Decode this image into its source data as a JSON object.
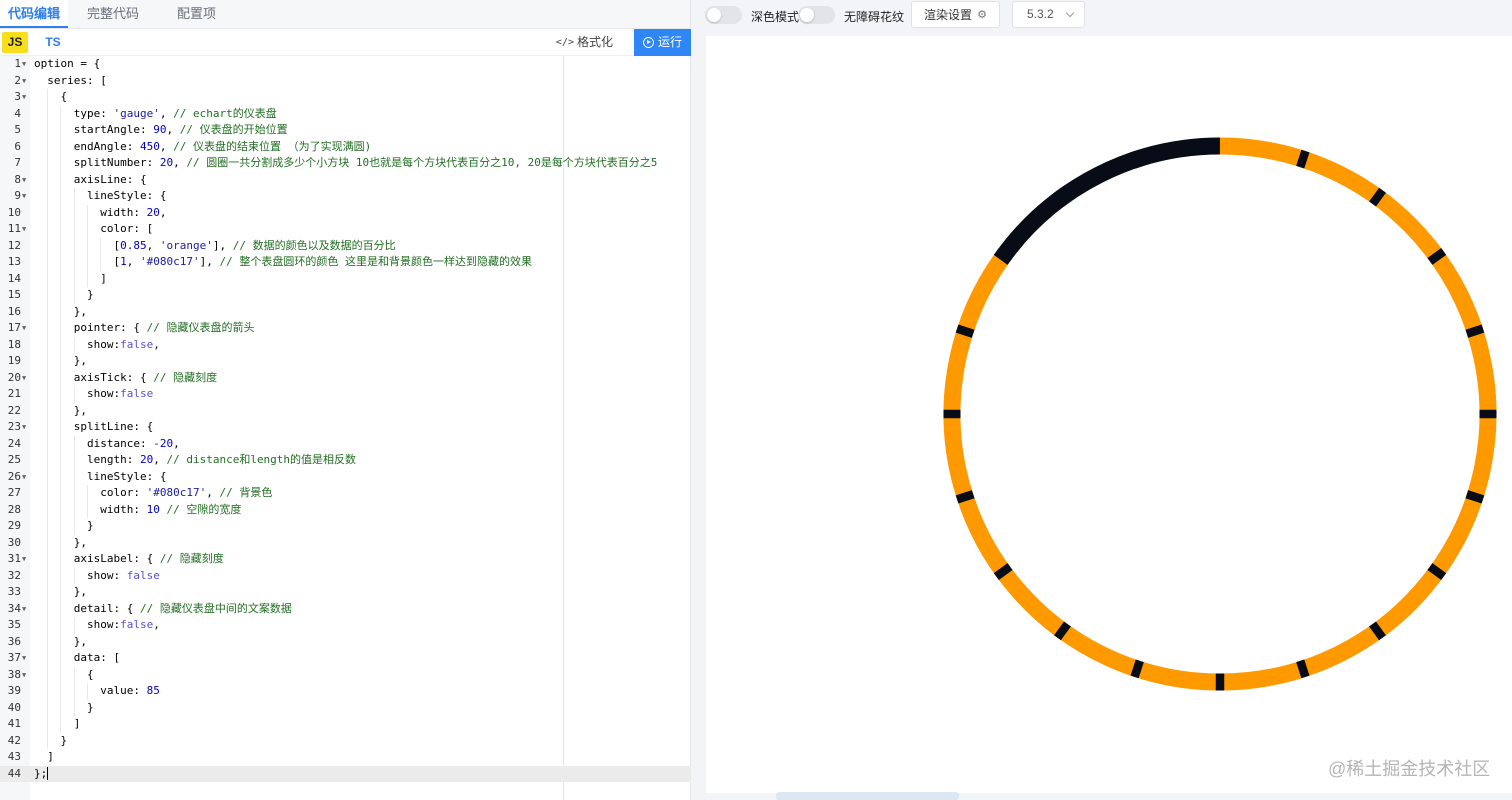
{
  "tabs": [
    {
      "label": "代码编辑",
      "active": true
    },
    {
      "label": "完整代码",
      "active": false
    },
    {
      "label": "配置项",
      "active": false
    }
  ],
  "lang": {
    "js": "JS",
    "ts": "TS"
  },
  "actions": {
    "format": "格式化",
    "format_icon": "</>",
    "run": "运行"
  },
  "code_lines": [
    [
      [
        "key",
        "option = {"
      ]
    ],
    [
      [
        "key",
        "  series: ["
      ]
    ],
    [
      [
        "key",
        "    {"
      ]
    ],
    [
      [
        "key",
        "      type: "
      ],
      [
        "str",
        "'gauge'"
      ],
      [
        "key",
        ", "
      ],
      [
        "com",
        "// echart的仪表盘"
      ]
    ],
    [
      [
        "key",
        "      startAngle: "
      ],
      [
        "num",
        "90"
      ],
      [
        "key",
        ", "
      ],
      [
        "com",
        "// 仪表盘的开始位置"
      ]
    ],
    [
      [
        "key",
        "      endAngle: "
      ],
      [
        "num",
        "450"
      ],
      [
        "key",
        ", "
      ],
      [
        "com",
        "// 仪表盘的结束位置 （为了实现满圆)"
      ]
    ],
    [
      [
        "key",
        "      splitNumber: "
      ],
      [
        "num",
        "20"
      ],
      [
        "key",
        ", "
      ],
      [
        "com",
        "// 圆圈一共分割成多少个小方块 10也就是每个方块代表百分之10, 20是每个方块代表百分之5"
      ]
    ],
    [
      [
        "key",
        "      axisLine: {"
      ]
    ],
    [
      [
        "key",
        "        lineStyle: {"
      ]
    ],
    [
      [
        "key",
        "          width: "
      ],
      [
        "num",
        "20"
      ],
      [
        "key",
        ","
      ]
    ],
    [
      [
        "key",
        "          color: ["
      ]
    ],
    [
      [
        "key",
        "            ["
      ],
      [
        "num",
        "0.85"
      ],
      [
        "key",
        ", "
      ],
      [
        "str",
        "'orange'"
      ],
      [
        "key",
        "], "
      ],
      [
        "com",
        "// 数据的颜色以及数据的百分比"
      ]
    ],
    [
      [
        "key",
        "            ["
      ],
      [
        "num",
        "1"
      ],
      [
        "key",
        ", "
      ],
      [
        "str",
        "'#080c17'"
      ],
      [
        "key",
        "], "
      ],
      [
        "com",
        "// 整个表盘圆环的颜色 这里是和背景颜色一样达到隐藏的效果"
      ]
    ],
    [
      [
        "key",
        "          ]"
      ]
    ],
    [
      [
        "key",
        "        }"
      ]
    ],
    [
      [
        "key",
        "      },"
      ]
    ],
    [
      [
        "key",
        "      pointer: { "
      ],
      [
        "com",
        "// 隐藏仪表盘的箭头"
      ]
    ],
    [
      [
        "key",
        "        show:"
      ],
      [
        "bool",
        "false"
      ],
      [
        "key",
        ","
      ]
    ],
    [
      [
        "key",
        "      },"
      ]
    ],
    [
      [
        "key",
        "      axisTick: { "
      ],
      [
        "com",
        "// 隐藏刻度"
      ]
    ],
    [
      [
        "key",
        "        show:"
      ],
      [
        "bool",
        "false"
      ]
    ],
    [
      [
        "key",
        "      },"
      ]
    ],
    [
      [
        "key",
        "      splitLine: {"
      ]
    ],
    [
      [
        "key",
        "        distance: "
      ],
      [
        "num",
        "-20"
      ],
      [
        "key",
        ","
      ]
    ],
    [
      [
        "key",
        "        length: "
      ],
      [
        "num",
        "20"
      ],
      [
        "key",
        ", "
      ],
      [
        "com",
        "// distance和length的值是相反数"
      ]
    ],
    [
      [
        "key",
        "        lineStyle: {"
      ]
    ],
    [
      [
        "key",
        "          color: "
      ],
      [
        "str",
        "'#080c17'"
      ],
      [
        "key",
        ", "
      ],
      [
        "com",
        "// 背景色"
      ]
    ],
    [
      [
        "key",
        "          width: "
      ],
      [
        "num",
        "10"
      ],
      [
        "key",
        " "
      ],
      [
        "com",
        "// 空隙的宽度"
      ]
    ],
    [
      [
        "key",
        "        }"
      ]
    ],
    [
      [
        "key",
        "      },"
      ]
    ],
    [
      [
        "key",
        "      axisLabel: { "
      ],
      [
        "com",
        "// 隐藏刻度"
      ]
    ],
    [
      [
        "key",
        "        show: "
      ],
      [
        "bool",
        "false"
      ]
    ],
    [
      [
        "key",
        "      },"
      ]
    ],
    [
      [
        "key",
        "      detail: { "
      ],
      [
        "com",
        "// 隐藏仪表盘中间的文案数据"
      ]
    ],
    [
      [
        "key",
        "        show:"
      ],
      [
        "bool",
        "false"
      ],
      [
        "key",
        ","
      ]
    ],
    [
      [
        "key",
        "      },"
      ]
    ],
    [
      [
        "key",
        "      data: ["
      ]
    ],
    [
      [
        "key",
        "        {"
      ]
    ],
    [
      [
        "key",
        "          value: "
      ],
      [
        "num",
        "85"
      ]
    ],
    [
      [
        "key",
        "        }"
      ]
    ],
    [
      [
        "key",
        "      ]"
      ]
    ],
    [
      [
        "key",
        "    }"
      ]
    ],
    [
      [
        "key",
        "  ]"
      ]
    ],
    [
      [
        "key",
        "};"
      ]
    ]
  ],
  "fold_lines": [
    1,
    2,
    3,
    8,
    9,
    11,
    17,
    20,
    23,
    26,
    31,
    34,
    37,
    38
  ],
  "current_line": 44,
  "toolbar": {
    "dark_mode": "深色模式",
    "accessible_pattern": "无障碍花纹",
    "render_settings": "渲染设置",
    "version": "5.3.2"
  },
  "watermark": "@稀土掘金技术社区",
  "chart_data": {
    "type": "gauge",
    "startAngle": 90,
    "endAngle": 450,
    "splitNumber": 20,
    "value": 85,
    "axisLine": {
      "width": 20,
      "color": [
        [
          0.85,
          "orange"
        ],
        [
          1,
          "#080c17"
        ]
      ]
    },
    "splitLine": {
      "distance": -20,
      "length": 20,
      "color": "#080c17",
      "width": 10
    },
    "colors": {
      "value": "#ff9900",
      "remainder": "#080c17",
      "gap": "#080c17"
    }
  }
}
